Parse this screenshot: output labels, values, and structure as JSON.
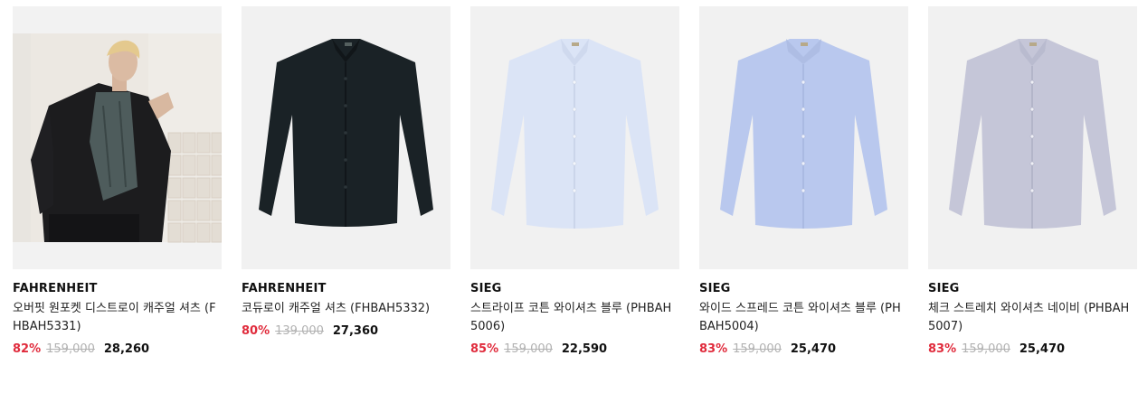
{
  "products": [
    {
      "brand": "FAHRENHEIT",
      "name": "오버핏 원포켓 디스트로이 캐주얼 셔츠 (FHBAH5331)",
      "discount": "82%",
      "original_price": "159,000",
      "sale_price": "28,260",
      "image": "model-photo",
      "shirt_color": "#3a4a4a"
    },
    {
      "brand": "FAHRENHEIT",
      "name": "코듀로이 캐주얼 셔츠 (FHBAH5332)",
      "discount": "80%",
      "original_price": "139,000",
      "sale_price": "27,360",
      "image": "shirt-dark",
      "shirt_color": "#1a2226"
    },
    {
      "brand": "SIEG",
      "name": "스트라이프 코튼 와이셔츠 블루 (PHBAH5006)",
      "discount": "85%",
      "original_price": "159,000",
      "sale_price": "22,590",
      "image": "shirt-lightblue",
      "shirt_color": "#dbe4f6"
    },
    {
      "brand": "SIEG",
      "name": "와이드 스프레드 코튼 와이셔츠 블루 (PHBAH5004)",
      "discount": "83%",
      "original_price": "159,000",
      "sale_price": "25,470",
      "image": "shirt-blue",
      "shirt_color": "#b9c8ee"
    },
    {
      "brand": "SIEG",
      "name": "체크 스트레치 와이셔츠 네이비 (PHBAH5007)",
      "discount": "83%",
      "original_price": "159,000",
      "sale_price": "25,470",
      "image": "shirt-grey",
      "shirt_color": "#c5c6d8"
    }
  ]
}
